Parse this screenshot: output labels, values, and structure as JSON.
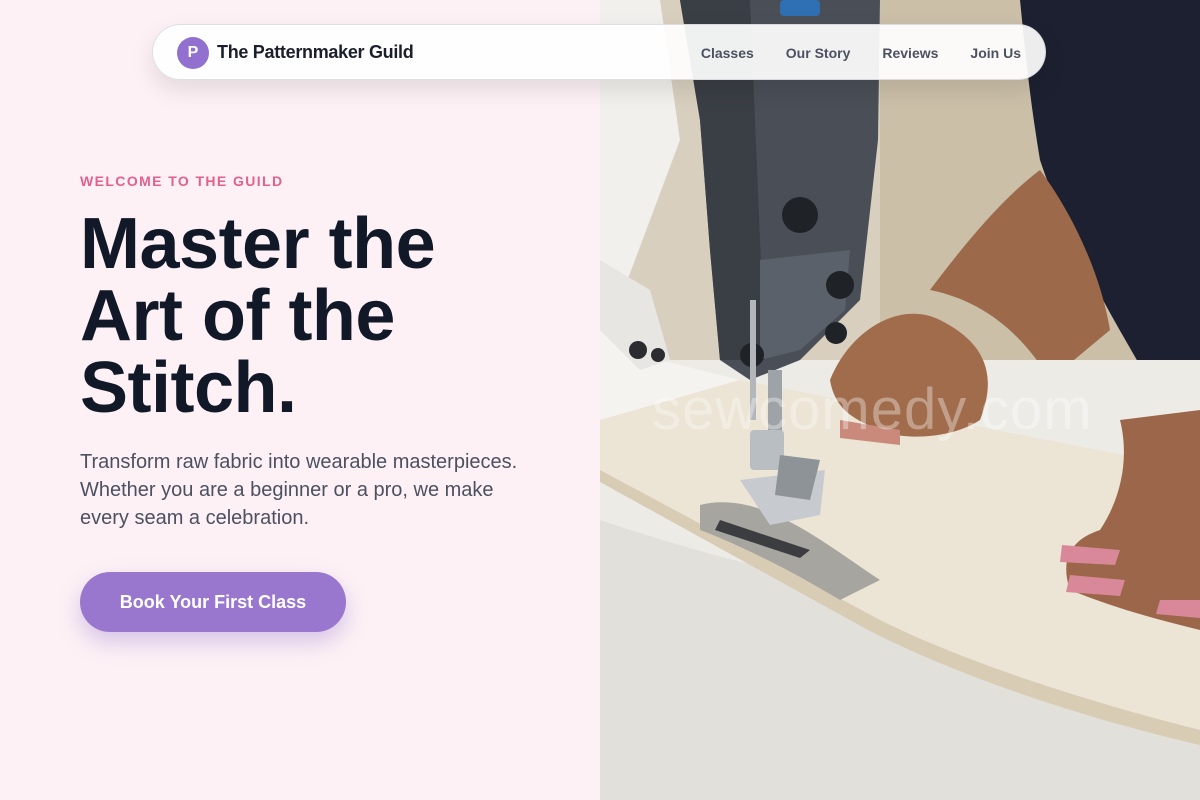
{
  "brand": {
    "initial": "P",
    "name": "The Patternmaker Guild"
  },
  "nav": {
    "links": [
      "Classes",
      "Our Story",
      "Reviews",
      "Join Us"
    ]
  },
  "hero": {
    "eyebrow": "WELCOME TO THE GUILD",
    "headline_lines": [
      "Master the",
      "Art of the",
      "Stitch."
    ],
    "lead_lines": [
      "Transform raw fabric into wearable masterpieces.",
      "Whether you are a beginner or a pro, we make",
      "every seam a celebration."
    ],
    "cta_label": "Book Your First Class"
  },
  "photo": {
    "watermark": "sewcomedy.com"
  },
  "colors": {
    "accent": "#9977cf",
    "eyebrow": "#e2608e",
    "heading": "#111827",
    "background": "#fdf1f5"
  }
}
